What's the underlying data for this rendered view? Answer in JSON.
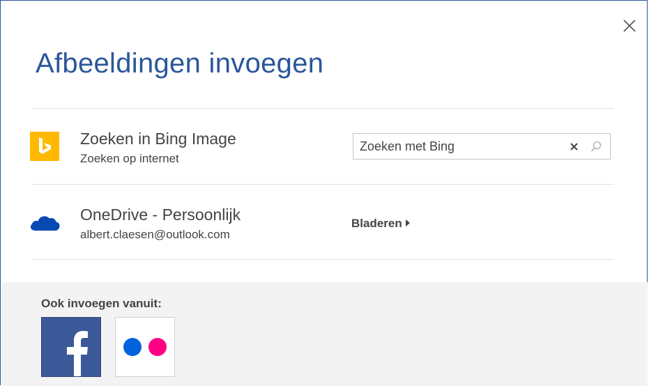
{
  "dialog": {
    "title": "Afbeeldingen invoegen",
    "close_icon": "close-icon"
  },
  "bing": {
    "icon": "bing-icon",
    "title": "Zoeken in Bing Image",
    "subtitle": "Zoeken op internet",
    "search_value": "Zoeken met Bing",
    "clear_icon": "clear-icon",
    "search_icon": "search-icon",
    "icon_color": "#ffb900"
  },
  "onedrive": {
    "icon": "onedrive-cloud-icon",
    "title": "OneDrive - Persoonlijk",
    "subtitle": "albert.claesen@outlook.com",
    "browse_label": "Bladeren",
    "icon_color": "#094ab2"
  },
  "footer": {
    "label": "Ook invoegen vanuit:",
    "sources": [
      {
        "name": "facebook",
        "icon": "facebook-icon",
        "color": "#3b5998"
      },
      {
        "name": "flickr",
        "icon": "flickr-icon",
        "colors": [
          "#0063dc",
          "#ff0084"
        ]
      }
    ]
  },
  "colors": {
    "accent": "#2b579a",
    "text": "#444444",
    "footer_bg": "#f3f3f3"
  }
}
